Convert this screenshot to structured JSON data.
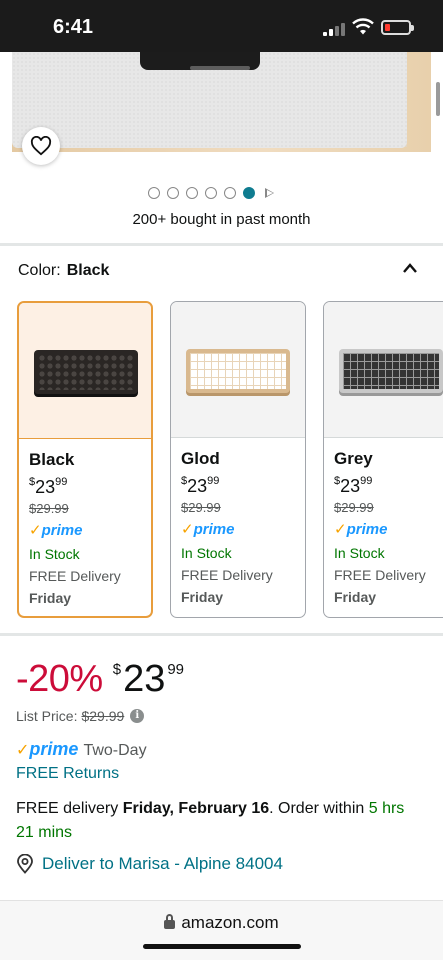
{
  "status_bar": {
    "time": "6:41"
  },
  "gallery": {
    "dots_total": 6,
    "dot_active_index": 5,
    "bought_text": "200+ bought in past month"
  },
  "color": {
    "label": "Color:",
    "selected": "Black"
  },
  "variants": [
    {
      "name": "Black",
      "price_sym": "$",
      "price_whole": "23",
      "price_frac": "99",
      "list_price": "$29.99",
      "prime": "prime",
      "stock": "In Stock",
      "delivery": "FREE Delivery",
      "day": "Friday"
    },
    {
      "name": "Glod",
      "price_sym": "$",
      "price_whole": "23",
      "price_frac": "99",
      "list_price": "$29.99",
      "prime": "prime",
      "stock": "In Stock",
      "delivery": "FREE Delivery",
      "day": "Friday"
    },
    {
      "name": "Grey",
      "price_sym": "$",
      "price_whole": "23",
      "price_frac": "99",
      "list_price": "$29.99",
      "prime": "prime",
      "stock": "In Stock",
      "delivery": "FREE Delivery",
      "day": "Friday"
    }
  ],
  "price": {
    "discount": "-20%",
    "symbol": "$",
    "whole": "23",
    "fraction": "99",
    "list_label": "List Price:",
    "list_value": "$29.99"
  },
  "prime_badge": {
    "check": "✓",
    "word": "prime",
    "two_day": "Two-Day"
  },
  "free_returns": "FREE Returns",
  "delivery": {
    "prefix": "FREE delivery ",
    "date": "Friday, February 16",
    "middle": ". Order within ",
    "countdown": "5 hrs 21 mins"
  },
  "deliver_to": "Deliver to Marisa - Alpine 84004",
  "browser": {
    "url": "amazon.com"
  },
  "colors": {
    "discount_red": "#cc0c39",
    "link_teal": "#007185",
    "stock_green": "#007600",
    "prime_blue": "#1a98ff",
    "selected_orange": "#e89d3c"
  }
}
